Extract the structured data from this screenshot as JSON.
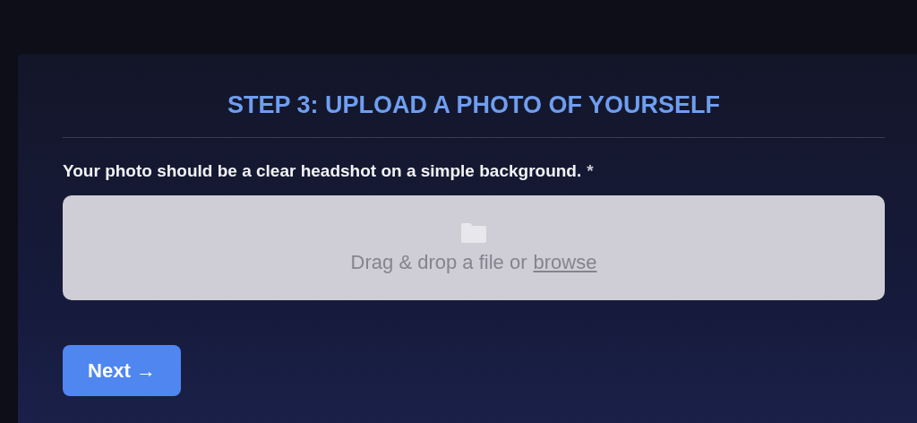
{
  "heading": "STEP 3: UPLOAD A PHOTO OF YOURSELF",
  "field": {
    "label": "Your photo should be a clear headshot on a simple background.",
    "required_mark": "*",
    "drop_text": "Drag & drop a file or",
    "browse_link": "browse"
  },
  "next_button": "Next →"
}
